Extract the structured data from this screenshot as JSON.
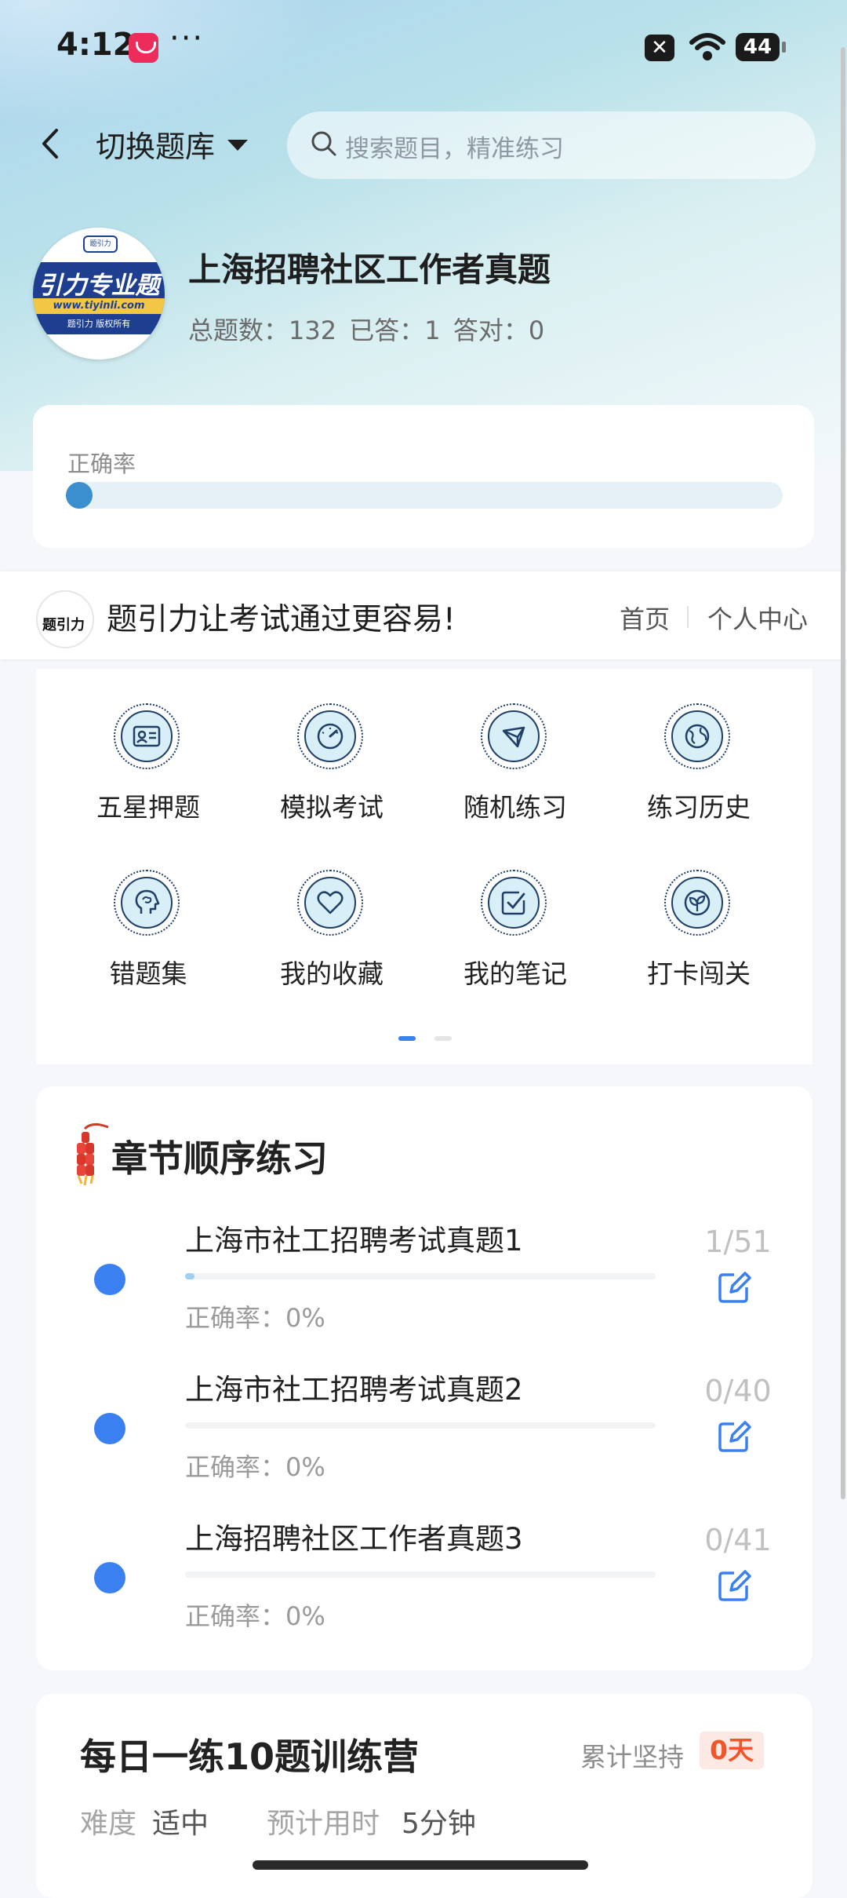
{
  "status_bar": {
    "time": "4:12",
    "overflow": "···",
    "battery": "44"
  },
  "header": {
    "switch_label": "切换题库",
    "search_placeholder": "搜索题目，精准练习"
  },
  "bank": {
    "logo": {
      "top_text": "题引力",
      "main_text": "引力专业题",
      "url": "www.tiyinli.com",
      "copyright": "题引力 版权所有"
    },
    "title": "上海招聘社区工作者真题",
    "total_label": "总题数：132",
    "answered_label": "已答：1",
    "correct_label": "答对：0"
  },
  "accuracy": {
    "label": "正确率",
    "value_percent": 0
  },
  "banner": {
    "logo_text": "题引力",
    "slogan": "题引力让考试通过更容易!",
    "home": "首页",
    "user_center": "个人中心"
  },
  "features": [
    {
      "label": "五星押题",
      "icon": "id-card-icon"
    },
    {
      "label": "模拟考试",
      "icon": "speedometer-icon"
    },
    {
      "label": "随机练习",
      "icon": "random-shape-icon"
    },
    {
      "label": "练习历史",
      "icon": "globe-icon"
    },
    {
      "label": "错题集",
      "icon": "head-brain-icon"
    },
    {
      "label": "我的收藏",
      "icon": "heart-icon"
    },
    {
      "label": "我的笔记",
      "icon": "check-note-icon"
    },
    {
      "label": "打卡闯关",
      "icon": "sprout-icon"
    }
  ],
  "chapters": {
    "title": "章节顺序练习",
    "items": [
      {
        "name": "上海市社工招聘考试真题1",
        "accuracy": "正确率：0%",
        "count": "1/51",
        "progress": 0.0196
      },
      {
        "name": "上海市社工招聘考试真题2",
        "accuracy": "正确率：0%",
        "count": "0/40",
        "progress": 0
      },
      {
        "name": "上海招聘社区工作者真题3",
        "accuracy": "正确率：0%",
        "count": "0/41",
        "progress": 0
      }
    ]
  },
  "daily": {
    "title": "每日一练10题训练营",
    "persist_label": "累计坚持",
    "persist_days": "0天",
    "difficulty_label": "难度",
    "difficulty_value": "适中",
    "time_label": "预计用时",
    "time_value": "5分钟"
  },
  "colors": {
    "accent_blue": "#3a80f0",
    "orange": "#f0562a"
  }
}
